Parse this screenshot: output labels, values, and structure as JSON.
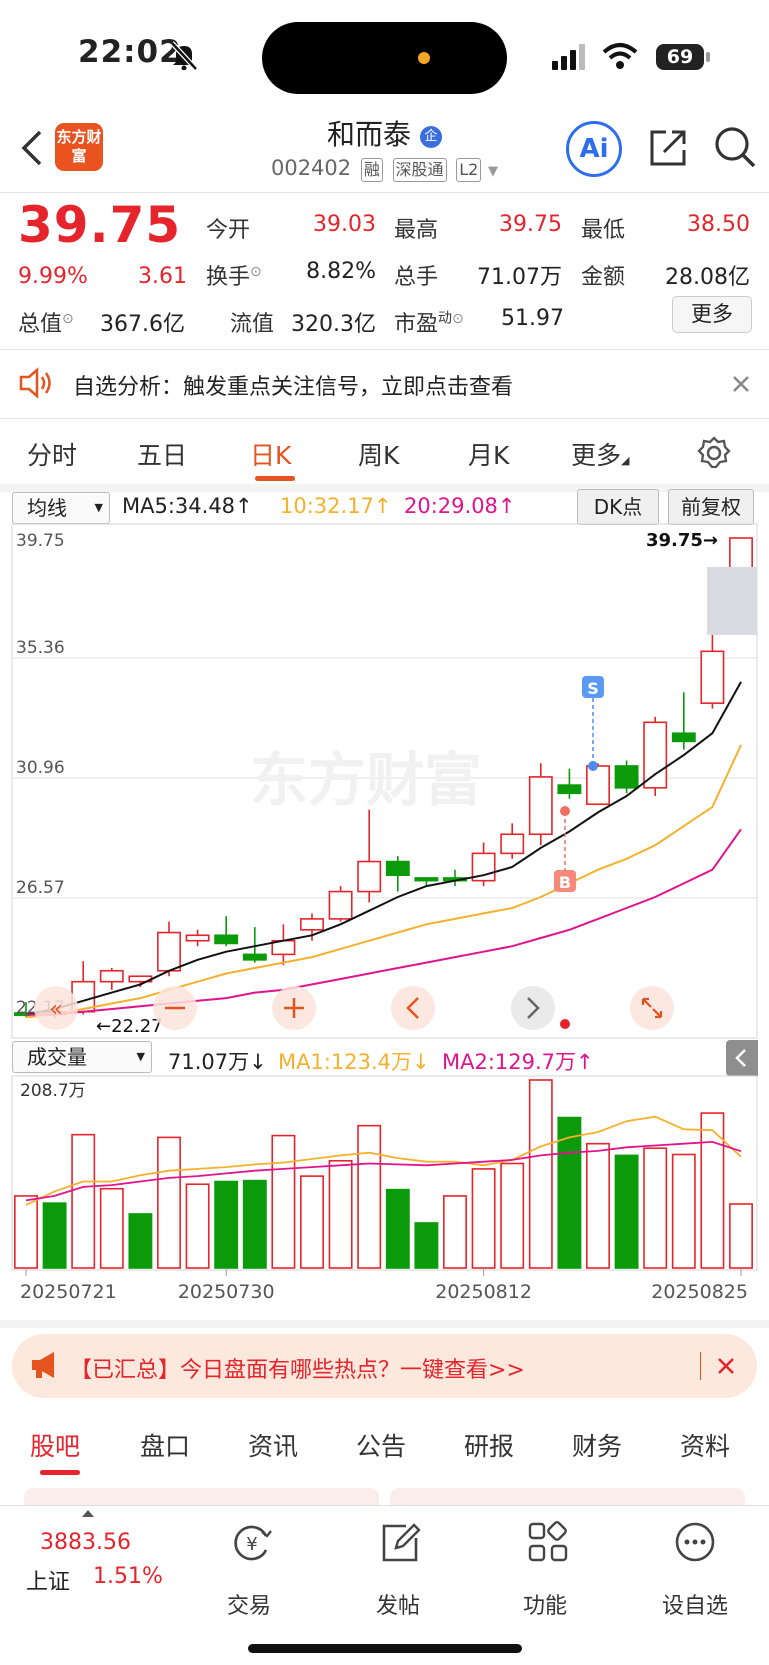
{
  "status_bar": {
    "time": "22:02",
    "battery": "69"
  },
  "header": {
    "logo_text": "东方财富",
    "stock_name": "和而泰",
    "name_badge": "企",
    "stock_code": "002402",
    "tags": [
      "融",
      "深股通",
      "L2"
    ],
    "ai_label": "Ai"
  },
  "quote": {
    "price": "39.75",
    "change_pct": "9.99%",
    "change_amt": "3.61",
    "open_label": "今开",
    "open": "39.03",
    "high_label": "最高",
    "high": "39.75",
    "low_label": "最低",
    "low": "38.50",
    "turnover_label": "换手",
    "turnover": "8.82%",
    "volume_label": "总手",
    "volume": "71.07万",
    "amount_label": "金额",
    "amount": "28.08亿",
    "mktcap_label": "总值",
    "mktcap": "367.6亿",
    "float_label": "流值",
    "float": "320.3亿",
    "pe_label": "市盈",
    "pe_sup": "动",
    "pe": "51.97",
    "more_label": "更多"
  },
  "alert": {
    "text": "自选分析：触发重点关注信号，立即点击查看"
  },
  "chart_tabs": [
    "分时",
    "五日",
    "日K",
    "周K",
    "月K",
    "更多"
  ],
  "chart_header": {
    "indicator_select": "均线",
    "ma5": "MA5:34.48↑",
    "ma10": "10:32.17↑",
    "ma20": "20:29.08↑",
    "dk_select": "DK点",
    "adjust_select": "前复权"
  },
  "price_chart": {
    "y_labels": [
      "39.75",
      "35.36",
      "30.96",
      "26.57",
      "22.17"
    ],
    "last_price_tag": "39.75→",
    "low_tag": "←22.27",
    "signal_s": "S",
    "signal_b": "B",
    "watermark": "东方财富"
  },
  "volume_header": {
    "select": "成交量",
    "vol": "71.07万↓",
    "ma1": "MA1:123.4万↓",
    "ma2": "MA2:129.7万↑",
    "max_label": "208.7万"
  },
  "x_labels": [
    "20250721",
    "20250730",
    "20250812",
    "20250825"
  ],
  "chart_data": {
    "type": "candlestick",
    "ohlc": [
      [
        22.35,
        22.75,
        22.2,
        22.27
      ],
      [
        22.3,
        22.4,
        22.17,
        22.4
      ],
      [
        22.4,
        24.25,
        22.3,
        23.5
      ],
      [
        23.5,
        24.0,
        23.2,
        23.9
      ],
      [
        23.5,
        23.6,
        23.3,
        23.7
      ],
      [
        23.9,
        25.7,
        23.7,
        25.3
      ],
      [
        25.0,
        25.4,
        24.8,
        25.2
      ],
      [
        25.2,
        25.9,
        24.8,
        24.9
      ],
      [
        24.5,
        25.5,
        24.2,
        24.3
      ],
      [
        24.5,
        25.6,
        24.1,
        25.0
      ],
      [
        25.4,
        26.0,
        25.0,
        25.8
      ],
      [
        25.8,
        27.0,
        25.7,
        26.8
      ],
      [
        26.8,
        29.8,
        26.4,
        27.9
      ],
      [
        27.9,
        28.1,
        26.8,
        27.4
      ],
      [
        27.3,
        27.3,
        27.0,
        27.2
      ],
      [
        27.3,
        27.6,
        27.0,
        27.2
      ],
      [
        27.2,
        28.6,
        27.0,
        28.2
      ],
      [
        28.2,
        29.3,
        28.0,
        28.9
      ],
      [
        28.9,
        31.5,
        28.5,
        31.0
      ],
      [
        30.7,
        31.3,
        30.2,
        30.4
      ],
      [
        30.0,
        31.5,
        30.0,
        31.4
      ],
      [
        31.4,
        31.6,
        30.4,
        30.6
      ],
      [
        30.6,
        33.2,
        30.3,
        33.0
      ],
      [
        32.6,
        34.1,
        32.0,
        32.3
      ],
      [
        33.7,
        36.5,
        33.5,
        35.6
      ],
      [
        38.5,
        39.75,
        38.5,
        39.75
      ]
    ],
    "ma_black": [
      22.3,
      22.5,
      22.8,
      23.1,
      23.4,
      23.9,
      24.3,
      24.6,
      24.8,
      25.0,
      25.2,
      25.6,
      26.1,
      26.6,
      27.0,
      27.2,
      27.4,
      27.7,
      28.4,
      29.0,
      29.7,
      30.3,
      31.1,
      31.8,
      32.6,
      34.48
    ],
    "ma_orange": [
      22.2,
      22.3,
      22.5,
      22.7,
      22.9,
      23.2,
      23.5,
      23.8,
      24.0,
      24.2,
      24.4,
      24.7,
      25.0,
      25.3,
      25.6,
      25.8,
      26.0,
      26.2,
      26.6,
      27.1,
      27.6,
      28.0,
      28.5,
      29.2,
      29.9,
      32.17
    ],
    "ma_pink": [
      22.3,
      22.3,
      22.4,
      22.5,
      22.6,
      22.7,
      22.8,
      22.9,
      23.1,
      23.2,
      23.4,
      23.6,
      23.8,
      24.0,
      24.2,
      24.4,
      24.6,
      24.8,
      25.1,
      25.4,
      25.8,
      26.2,
      26.6,
      27.1,
      27.6,
      29.08
    ],
    "ylim": [
      22.17,
      39.75
    ],
    "volume": [
      80,
      72,
      148,
      88,
      60,
      145,
      93,
      96,
      97,
      147,
      102,
      119,
      158,
      87,
      50,
      80,
      110,
      116,
      208.7,
      167,
      138,
      125,
      133,
      126,
      172,
      71.07
    ],
    "volume_up": [
      true,
      false,
      true,
      true,
      false,
      true,
      true,
      false,
      false,
      true,
      true,
      true,
      true,
      false,
      false,
      true,
      true,
      true,
      true,
      false,
      true,
      false,
      true,
      true,
      true,
      true
    ],
    "vol_ma1": [
      70,
      85,
      96,
      96,
      103,
      108,
      110,
      112,
      115,
      117,
      121,
      125,
      128,
      122,
      118,
      118,
      114,
      120,
      135,
      145,
      151,
      163,
      168,
      154,
      153,
      123.4
    ],
    "vol_ma2": [
      75,
      80,
      90,
      92,
      96,
      100,
      102,
      105,
      108,
      110,
      112,
      114,
      116,
      115,
      114,
      116,
      118,
      120,
      125,
      128,
      130,
      134,
      136,
      138,
      140,
      129.7
    ],
    "vol_ylim": [
      0,
      208.7
    ]
  },
  "banner": {
    "text": "【已汇总】今日盘面有哪些热点？一键查看>>"
  },
  "bottom_tabs": [
    "股吧",
    "盘口",
    "资讯",
    "公告",
    "研报",
    "财务",
    "资料"
  ],
  "index": {
    "value": "3883.56",
    "name": "上证",
    "pct": "1.51%"
  },
  "bottom_nav": [
    "交易",
    "发帖",
    "功能",
    "设自选"
  ]
}
